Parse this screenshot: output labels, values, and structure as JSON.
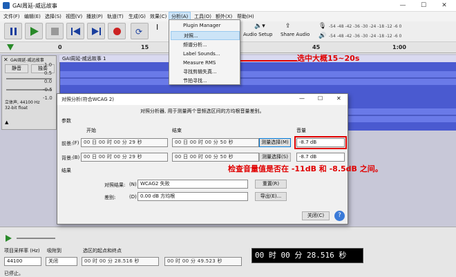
{
  "window": {
    "title": "GAI周延-威远故事"
  },
  "menu": [
    "文件(F)",
    "编辑(E)",
    "选择(S)",
    "视图(V)",
    "播放(P)",
    "轨道(T)",
    "生成(G)",
    "效果(C)",
    "分析(A)",
    "工具(O)",
    "额外(X)",
    "帮助(H)"
  ],
  "analyze_menu": [
    "Plugin Manager",
    "对照...",
    "频谱分析...",
    "Label Sounds...",
    "Measure RMS",
    "寻找剪辑失真...",
    "节拍寻找..."
  ],
  "toolbar": {
    "audio_setup": "Audio Setup",
    "share_audio": "Share Audio",
    "meter_ticks": "-54 -48 -42 -36 -30 -24 -18 -12 -6 0"
  },
  "ruler": {
    "ticks": [
      "0",
      "15",
      "45",
      "1:00"
    ]
  },
  "track": {
    "name": "GAI周延-威远故事",
    "clip_name": "GAI周延-威远故事 1",
    "mute": "静音",
    "solo": "独奏",
    "info": "立体声, 44100 Hz\n32-bit float",
    "db": [
      "1.0",
      "0.5",
      "0.0",
      "-0.5",
      "-1.0"
    ],
    "db2": [
      "1.0",
      "0.5",
      "0.0",
      "-0.5",
      "-1.0"
    ]
  },
  "dialog": {
    "title": "对照分析(符合WCAG 2)",
    "description": "对照分析器, 用于测量两个音频选区间的方均根音量差别。",
    "params_label": "参数",
    "start_label": "开始",
    "end_label": "结束",
    "volume_label": "音量",
    "fg_label": "前景:",
    "fg_key": "(F)",
    "bg_label": "背景:",
    "bg_key": "(B)",
    "fg_start": "00 日 00 时 00 分 29 秒",
    "fg_end": "00 日 00 时 00 分 50 秒",
    "bg_start": "00 日 00 时 00 分 29 秒",
    "bg_end": "00 日 00 时 00 分 50 秒",
    "measure_fg": "测量选择(M)",
    "measure_bg": "测量选择(S)",
    "fg_volume": "-8.7 dB",
    "bg_volume": "-8.7 dB",
    "results_label": "结果",
    "result_label": "对照结果:",
    "result_key": "(N)",
    "result_value": "WCAG2 失败",
    "diff_label": "差别:",
    "diff_key": "(D)",
    "diff_value": "0.00 dB 方均根",
    "reset": "重置(R)",
    "export": "导出(E)...",
    "close": "关闭(C)",
    "help": "?"
  },
  "annotations": {
    "select": "选中大概15~20s",
    "check": "检查音量值是否在 -11dB 和 -8.5dB 之间。"
  },
  "status": {
    "rate_label": "项目采样率 (Hz)",
    "snap_label": "吸附到",
    "rate_value": "44100",
    "snap_value": "关闭",
    "selection_label": "选区的起点和终点",
    "sel_start": "00 时 00 分 28.516 秒",
    "sel_end": "00 时 00 分 49.523 秒",
    "big_time": "00 时 00 分 28.516 秒",
    "status_text": "已停止。"
  },
  "colors": {
    "waveform": "#4455cc",
    "annotation": "#e00000",
    "highlight": "#cce4f7"
  }
}
